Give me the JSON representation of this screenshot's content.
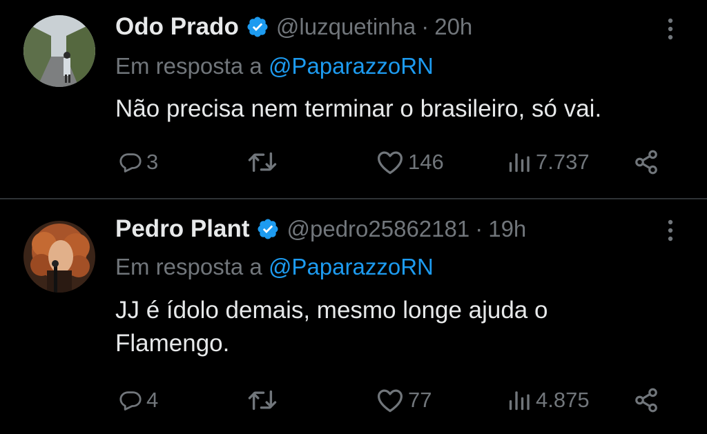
{
  "tweets": [
    {
      "display_name": "Odo Prado",
      "handle": "@luzquetinha",
      "separator": "·",
      "time": "20h",
      "reply_prefix": "Em resposta a",
      "reply_mention": "@PaparazzoRN",
      "text": "Não precisa nem terminar o brasileiro, só vai.",
      "replies": "3",
      "retweets": "",
      "likes": "146",
      "views": "7.737"
    },
    {
      "display_name": "Pedro Plant",
      "handle": "@pedro25862181",
      "separator": "·",
      "time": "19h",
      "reply_prefix": "Em resposta a",
      "reply_mention": "@PaparazzoRN",
      "text": "JJ é ídolo demais,  mesmo longe ajuda o Flamengo.",
      "replies": "4",
      "retweets": "",
      "likes": "77",
      "views": "4.875"
    }
  ],
  "icons": {
    "verified": "verified-badge-icon",
    "more": "more-options-icon",
    "reply": "reply-icon",
    "retweet": "retweet-icon",
    "like": "heart-icon",
    "views": "views-icon",
    "share": "share-icon"
  },
  "colors": {
    "background": "#000000",
    "text": "#e7e9ea",
    "muted": "#71767b",
    "accent": "#1d9bf0",
    "divider": "#2f3336"
  }
}
